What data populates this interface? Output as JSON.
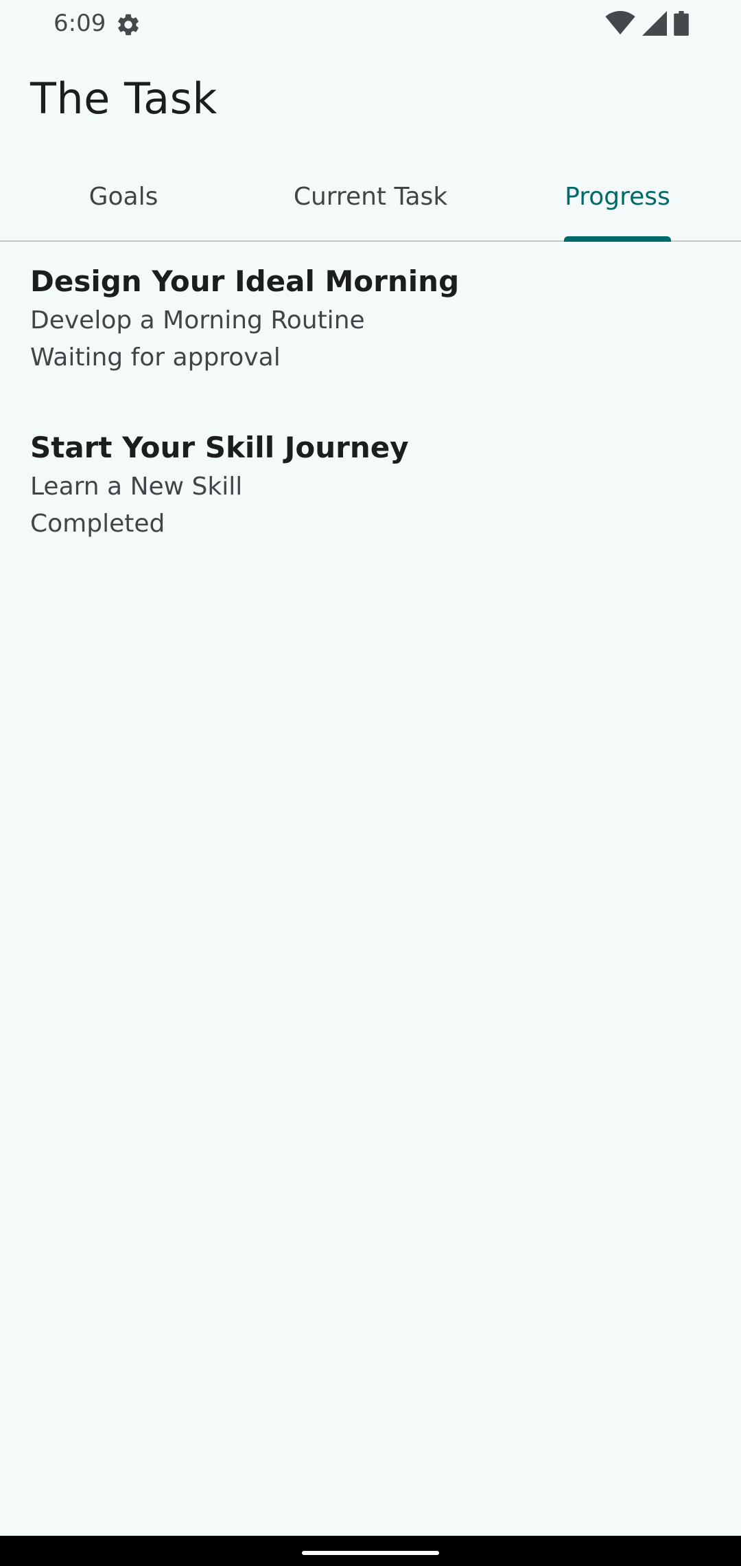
{
  "status_bar": {
    "time": "6:09",
    "icons": [
      "settings-gear-icon",
      "wifi-icon",
      "cell-signal-icon",
      "battery-icon"
    ]
  },
  "app": {
    "title": "The Task"
  },
  "tabs": [
    {
      "label": "Goals",
      "active": false
    },
    {
      "label": "Current Task",
      "active": false
    },
    {
      "label": "Progress",
      "active": true
    }
  ],
  "progress": [
    {
      "title": "Design Your Ideal Morning",
      "task": "Develop a Morning Routine",
      "status": "Waiting for approval"
    },
    {
      "title": "Start Your Skill Journey",
      "task": "Learn a New Skill",
      "status": "Completed"
    }
  ],
  "colors": {
    "background": "#f4fafa",
    "accent": "#006a6a",
    "divider": "#c4c9ca"
  }
}
